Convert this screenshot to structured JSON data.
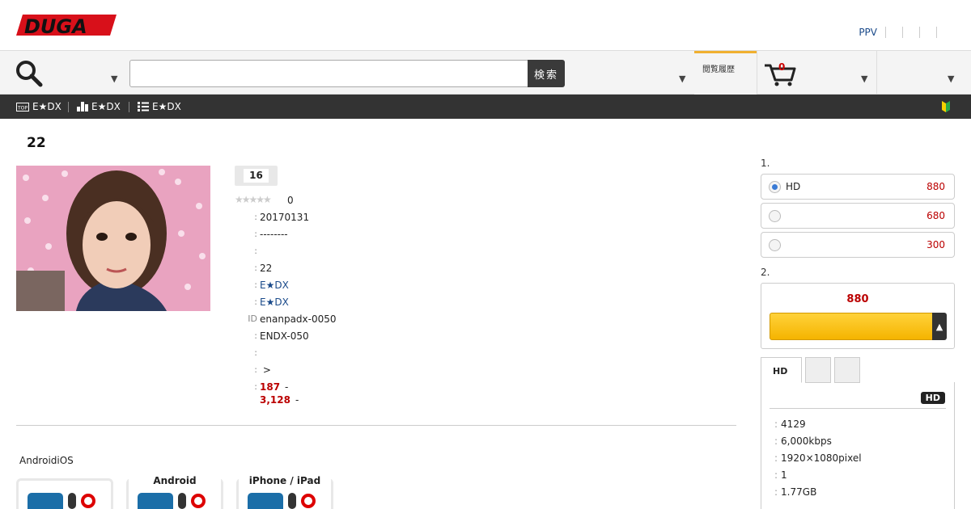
{
  "header": {
    "logo_text": "DUGA",
    "toplinks": [
      "PPV",
      "",
      "",
      "",
      ""
    ]
  },
  "search": {
    "button_label": "検索",
    "placeholder": ""
  },
  "history_tab_label": "閲覧履歴",
  "cart": {
    "count": "0"
  },
  "darknav": {
    "items": [
      {
        "icon": "top-icon",
        "label": "E★DX"
      },
      {
        "icon": "ranking-icon",
        "label": "E★DX"
      },
      {
        "icon": "list-icon",
        "label": "E★DX"
      }
    ],
    "beginner_icon": "beginner-mark-icon"
  },
  "product": {
    "title": "22",
    "age_badge": "16",
    "rating_stars": "★★★★★",
    "rating_count": "0",
    "info": [
      {
        "label": ":",
        "value": "20170131",
        "style": ""
      },
      {
        "label": ":",
        "value": "--------",
        "style": ""
      },
      {
        "label": ":",
        "value": "",
        "style": ""
      },
      {
        "label": ":",
        "value": "22",
        "style": ""
      },
      {
        "label": ":",
        "value": "E★DX",
        "style": "link"
      },
      {
        "label": ":",
        "value": "E★DX",
        "style": "link"
      },
      {
        "label": "ID",
        "value": "enanpadx-0050",
        "style": ""
      },
      {
        "label": ":",
        "value": "ENDX-050",
        "style": ""
      },
      {
        "label": ":",
        "value": "",
        "style": ""
      },
      {
        "label": ":",
        "value": " >",
        "style": ""
      }
    ],
    "ranking": [
      {
        "label": ":",
        "value": "187",
        "suffix": "-"
      },
      {
        "label": "",
        "value": "3,128",
        "suffix": "-"
      }
    ]
  },
  "devices": {
    "title": "AndroidiOS",
    "items": [
      {
        "name": "",
        "icon": "pc-icon"
      },
      {
        "name": "Android",
        "icon": "android-icon"
      },
      {
        "name": "iPhone / iPad",
        "icon": "apple-icon"
      }
    ]
  },
  "purchase": {
    "step1": "1.",
    "options": [
      {
        "name": "HD",
        "price": "880",
        "selected": true
      },
      {
        "name": "",
        "price": "680",
        "selected": false
      },
      {
        "name": "",
        "price": "300",
        "selected": false
      }
    ],
    "step2": "2.",
    "price": "880",
    "buy_button": "",
    "buy_arrow": "▲"
  },
  "spec_tabs": {
    "tabs": [
      "HD",
      "",
      ""
    ],
    "badge": "HD",
    "specs": [
      {
        "label": ":",
        "value": "4129"
      },
      {
        "label": ":",
        "value": "6,000kbps"
      },
      {
        "label": ":",
        "value": "1920×1080pixel"
      },
      {
        "label": ":",
        "value": "1"
      },
      {
        "label": ":",
        "value": "1.77GB"
      }
    ]
  },
  "colors": {
    "accent": "#f5b400",
    "price_red": "#b00000",
    "nav_dark": "#333333",
    "link": "#1a4a8a"
  }
}
